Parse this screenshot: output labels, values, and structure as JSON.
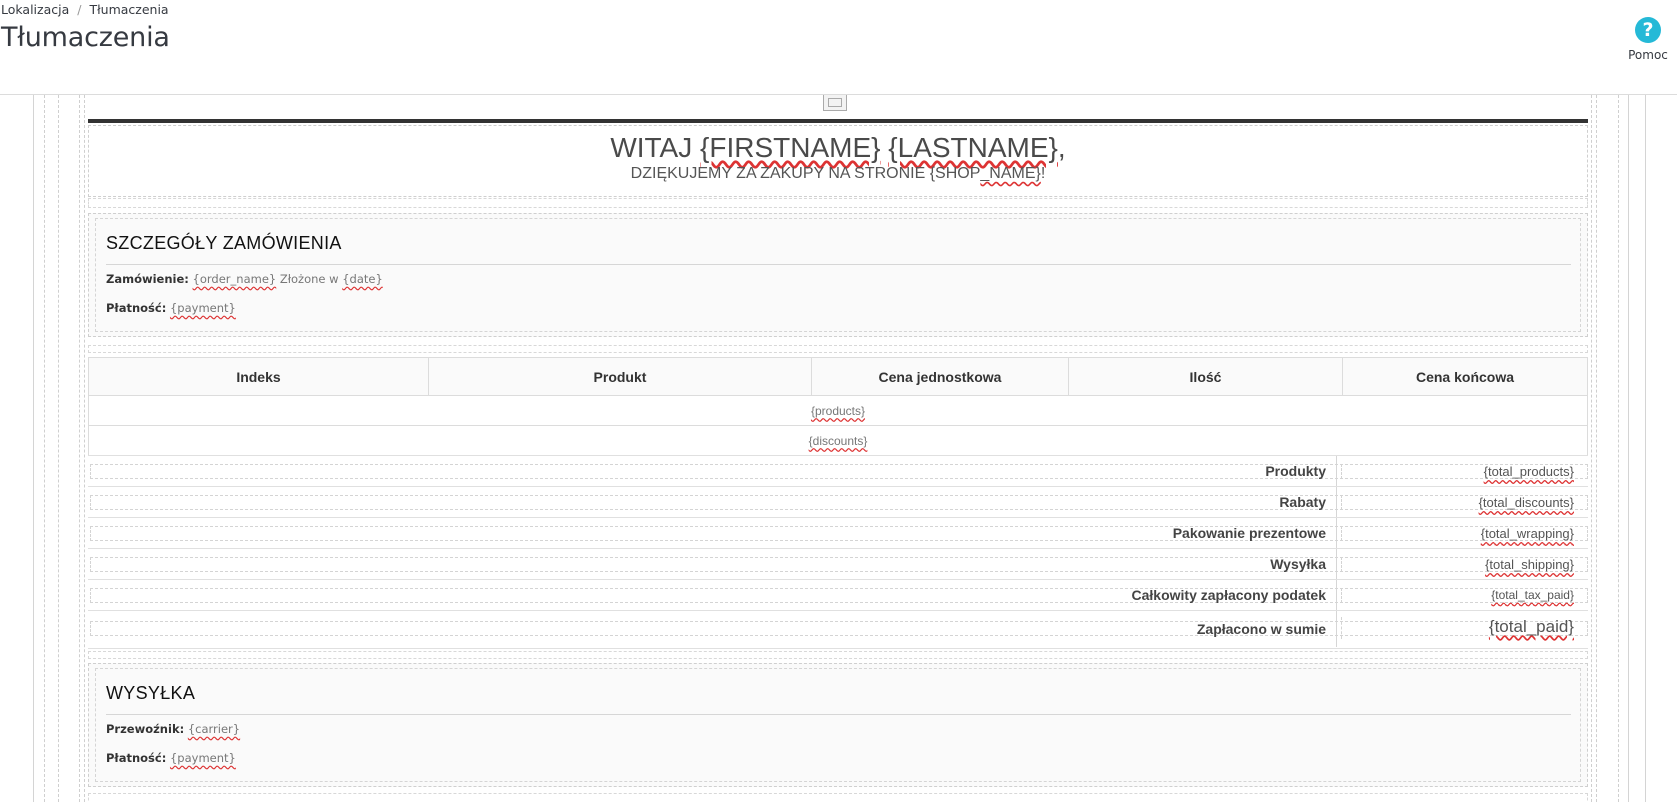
{
  "header": {
    "breadcrumb": [
      "Lokalizacja",
      "Tłumaczenia"
    ],
    "breadcrumb_separator": "/",
    "title": "Tłumaczenia",
    "help_label": "Pomoc",
    "help_icon": "question-circle-icon",
    "help_color": "#25b9d7"
  },
  "email": {
    "greeting_prefix": "WITAJ ",
    "greeting_vars": [
      "{FIRSTNAME}",
      "{LASTNAME}"
    ],
    "greeting_suffix": ",",
    "thanks_prefix": "DZIĘKUJEMY ZA ZAKUPY NA STRONIE {SHOP",
    "thanks_var": "_NAME}",
    "thanks_suffix": "!",
    "order_details": {
      "title": "SZCZEGÓŁY ZAMÓWIENIA",
      "order_label": "Zamówienie:",
      "order_value": "{order_name}",
      "placed_label": "Złożone w",
      "placed_value": "{date}",
      "payment_label": "Płatność:",
      "payment_value": "{payment}"
    },
    "table": {
      "headers": [
        "Indeks",
        "Produkt",
        "Cena jednostkowa",
        "Ilość",
        "Cena końcowa"
      ],
      "products_row": "{products}",
      "discounts_row": "{discounts}",
      "totals": [
        {
          "label": "Produkty",
          "value": "{total_products}"
        },
        {
          "label": "Rabaty",
          "value": "{total_discounts}"
        },
        {
          "label": "Pakowanie prezentowe",
          "value": "{total_wrapping}"
        },
        {
          "label": "Wysyłka",
          "value": "{total_shipping}"
        },
        {
          "label": "Całkowity zapłacony podatek",
          "value": "{total_tax_paid}"
        },
        {
          "label": "Zapłacono w sumie",
          "value": "{total_paid}"
        }
      ]
    },
    "shipping": {
      "title": "WYSYŁKA",
      "carrier_label": "Przewoźnik:",
      "carrier_value": "{carrier}",
      "payment_label": "Płatność:",
      "payment_value": "{payment}"
    }
  }
}
